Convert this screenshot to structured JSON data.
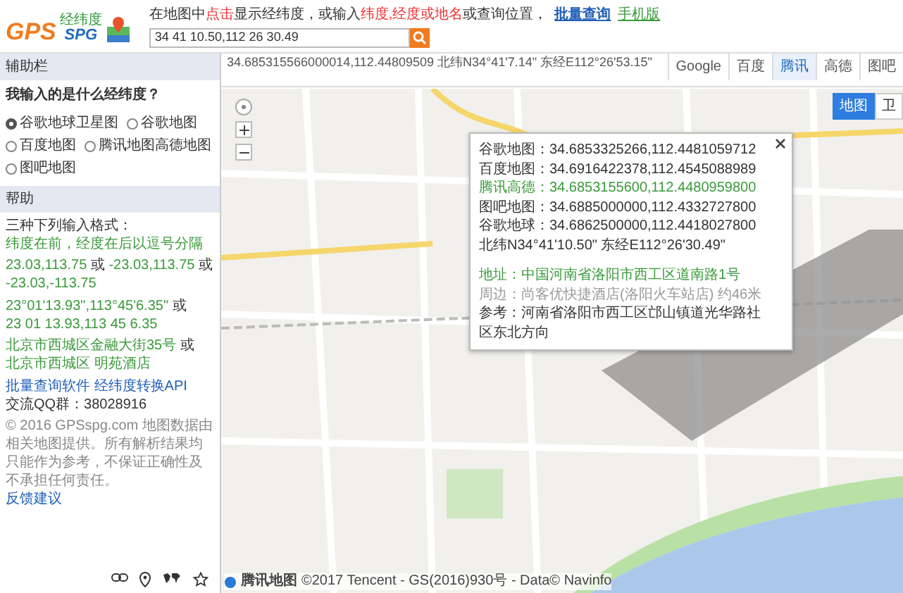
{
  "logo": {
    "gps": "GPS",
    "spg": "SPG",
    "tag": "经纬度"
  },
  "header": {
    "hint": [
      {
        "text": "在地图中",
        "kind": "plain"
      },
      {
        "text": "点击",
        "kind": "red"
      },
      {
        "text": "显示经纬度，或输入",
        "kind": "plain"
      },
      {
        "text": "纬度,经度或地名",
        "kind": "red"
      },
      {
        "text": "或查询位置，",
        "kind": "plain"
      }
    ],
    "links": [
      "批量查询",
      "手机版"
    ],
    "search": {
      "value": "34 41 10.50,112 26 30.49"
    }
  },
  "sidebar": {
    "title": "辅助栏",
    "question": "我输入的是什么经纬度？",
    "options": [
      {
        "label": "谷歌地球卫星图",
        "selected": true
      },
      {
        "label": "谷歌地图",
        "selected": false
      },
      {
        "label": "百度地图",
        "selected": false
      },
      {
        "label": "腾讯地图高德地图",
        "selected": false
      },
      {
        "label": "图吧地图",
        "selected": false
      }
    ],
    "help_title": "帮助",
    "help_lines": [
      [
        {
          "text": "三种下列输入格式：",
          "kind": "plain"
        },
        {
          "text": "纬度在前，经度在后以逗号分隔",
          "kind": "example"
        }
      ],
      [
        {
          "text": "23.03,113.75",
          "kind": "example"
        },
        {
          "text": "或",
          "kind": "plain"
        },
        {
          "text": "-23.03,113.75",
          "kind": "example"
        },
        {
          "text": "或",
          "kind": "plain"
        },
        {
          "text": "-23.03,-113.75",
          "kind": "example"
        }
      ],
      [
        {
          "text": "23°01'13.93\",113°45'6.35\"",
          "kind": "example"
        },
        {
          "text": "或",
          "kind": "plain"
        },
        {
          "text": "23 01 13.93,113 45 6.35",
          "kind": "example"
        }
      ],
      [
        {
          "text": "北京市西城区金融大街35号",
          "kind": "example"
        },
        {
          "text": "或",
          "kind": "plain"
        },
        {
          "text": "北京市西城区 明苑酒店",
          "kind": "example"
        }
      ],
      [
        {
          "text": "批量查询软件",
          "kind": "link"
        },
        {
          "text": "经纬度转换API",
          "kind": "link"
        },
        {
          "text": "交流QQ群：38028916",
          "kind": "plain"
        }
      ],
      [
        {
          "text": "© 2016 GPSspg.com 地图数据由相关地图提供。所有解析结果均只能作为参考，不保证正确性及不承担任何责任。",
          "kind": "note"
        },
        {
          "text": "反馈建议",
          "kind": "link"
        }
      ]
    ]
  },
  "map": {
    "coordinates": "34.685315566000014,112.44809509 北纬N34°41'7.14\" 东经E112°26'53.15\"",
    "providers": [
      {
        "label": "Google",
        "selected": false
      },
      {
        "label": "百度",
        "selected": false
      },
      {
        "label": "腾讯",
        "selected": true
      },
      {
        "label": "高德",
        "selected": false
      },
      {
        "label": "图吧",
        "selected": false
      }
    ],
    "view_modes": [
      {
        "label": "地图",
        "selected": true
      },
      {
        "label": "卫",
        "selected": false
      }
    ],
    "popup": {
      "lines": [
        {
          "text": "谷歌地图：34.6853325266,112.4481059712",
          "kind": "coord"
        },
        {
          "text": "百度地图：34.6916422378,112.4545088989",
          "kind": "coord"
        },
        {
          "text": "腾讯高德：34.6853155600,112.4480959800",
          "kind": "current"
        },
        {
          "text": "图吧地图：34.6885000000,112.4332727800",
          "kind": "coord"
        },
        {
          "text": "谷歌地球：34.6862500000,112.4418027800",
          "kind": "coord"
        },
        {
          "text": "北纬N34°41'10.50\" 东经E112°26'30.49\"",
          "kind": "coord"
        },
        {
          "text": "地址：中国河南省洛阳市西工区道南路1号",
          "kind": "address"
        },
        {
          "text": "周边：尚客优快捷酒店(洛阳火车站店) 约46米",
          "kind": "nearby"
        },
        {
          "text": "参考：河南省洛阳市西工区邙山镇道光华路社区东北方向",
          "kind": "reference"
        }
      ]
    },
    "attribution": {
      "brand": "腾讯地图",
      "text": "©2017 Tencent - GS(2016)930号 - Data© Navinfo"
    }
  }
}
